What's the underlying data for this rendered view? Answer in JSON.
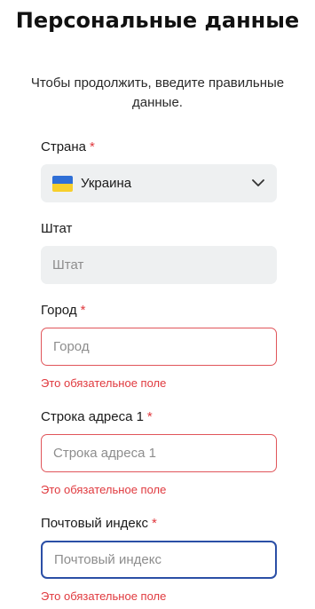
{
  "header": {
    "title": "Персональные данные",
    "subtitle": "Чтобы продолжить, введите правильные данные."
  },
  "form": {
    "country": {
      "label": "Страна",
      "required_mark": "*",
      "value": "Украина",
      "flag_icon": "ukraine-flag-icon",
      "flag_colors": [
        "#2f6fd6",
        "#f7cf2c"
      ]
    },
    "state": {
      "label": "Штат",
      "placeholder": "Штат"
    },
    "city": {
      "label": "Город",
      "required_mark": "*",
      "placeholder": "Город",
      "error": "Это обязательное поле"
    },
    "address_line1": {
      "label": "Строка адреса 1",
      "required_mark": "*",
      "placeholder": "Строка адреса 1",
      "error": "Это обязательное поле"
    },
    "postal_code": {
      "label": "Почтовый индекс",
      "required_mark": "*",
      "placeholder": "Почтовый индекс",
      "error": "Это обязательное поле"
    }
  },
  "colors": {
    "error": "#e0393e",
    "focus_border": "#2b4fa6",
    "field_background": "#eef0f1"
  }
}
